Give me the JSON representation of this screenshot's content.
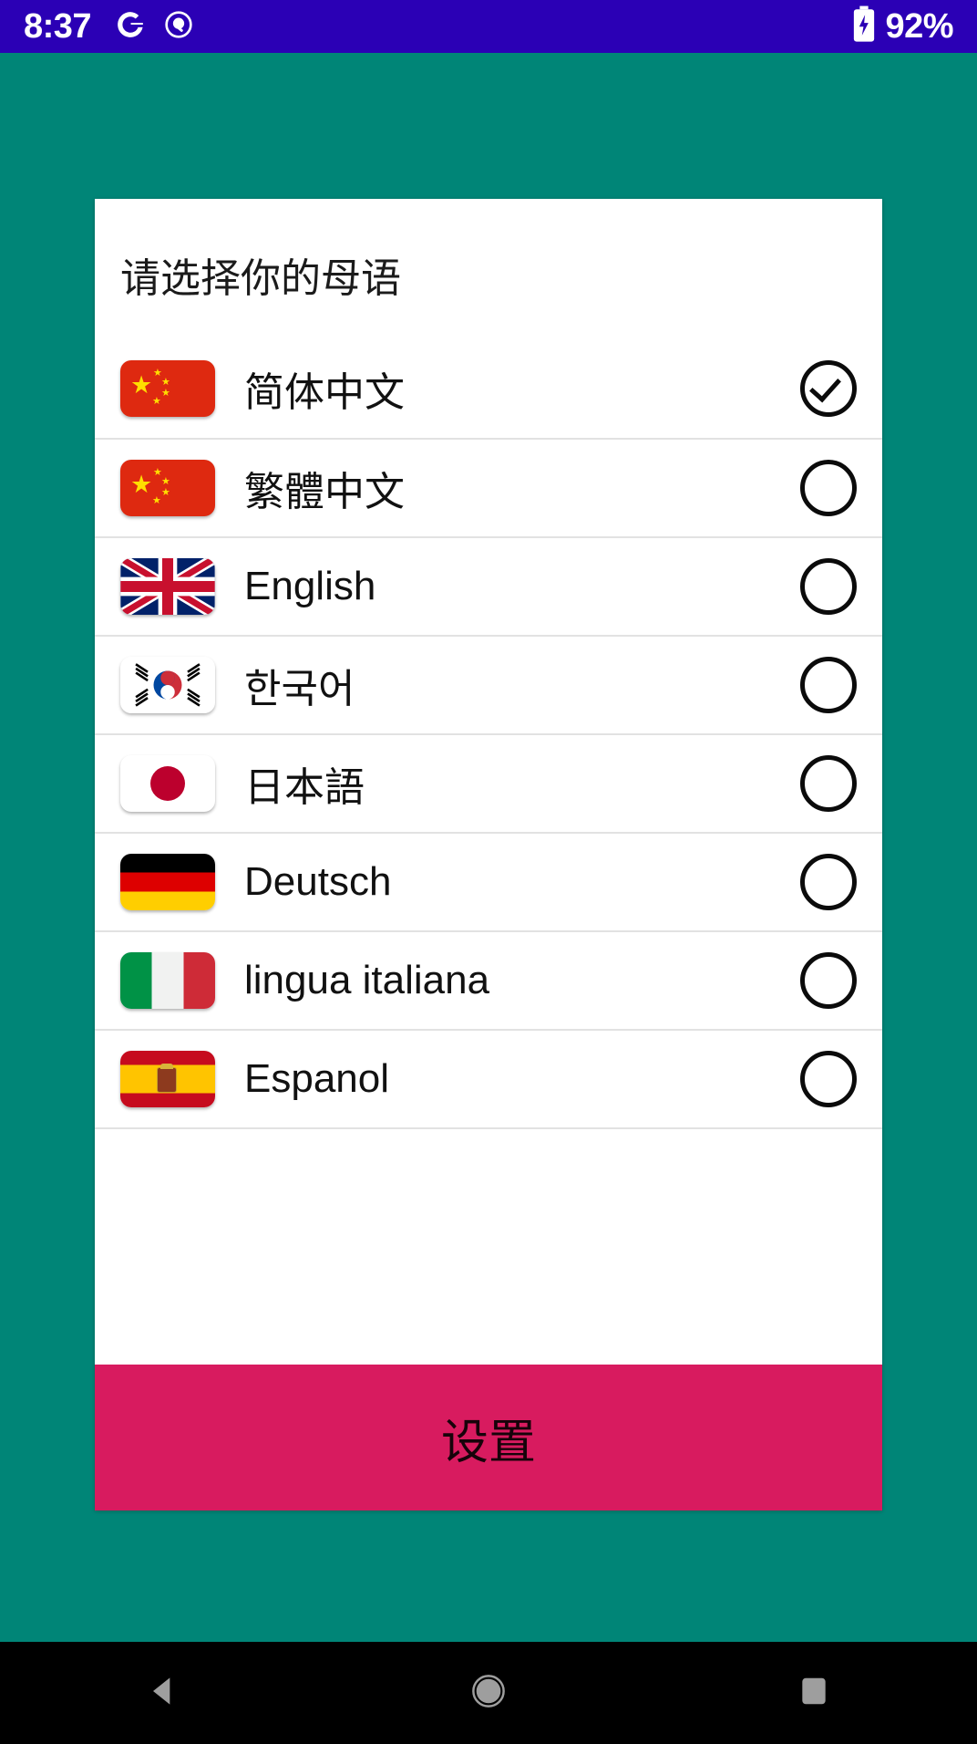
{
  "status_bar": {
    "clock": "8:37",
    "left_icons": [
      "google-g-icon",
      "dnd-icon"
    ],
    "battery_icon": "battery-charging-icon",
    "battery_percent": "92%",
    "background_color": "#2B00B5"
  },
  "background_color": "#008577",
  "card": {
    "title": "请选择你的母语",
    "background_color": "#FFFFFF",
    "languages": [
      {
        "label": "简体中文",
        "flag": "flag-china",
        "selected": true
      },
      {
        "label": "繁體中文",
        "flag": "flag-china",
        "selected": false
      },
      {
        "label": "English",
        "flag": "flag-united-kingdom",
        "selected": false
      },
      {
        "label": "한국어",
        "flag": "flag-south-korea",
        "selected": false
      },
      {
        "label": "日本語",
        "flag": "flag-japan",
        "selected": false
      },
      {
        "label": "Deutsch",
        "flag": "flag-germany",
        "selected": false
      },
      {
        "label": "lingua italiana",
        "flag": "flag-italy",
        "selected": false
      },
      {
        "label": "Espanol",
        "flag": "flag-spain",
        "selected": false
      }
    ]
  },
  "confirm_button": {
    "label": "设置",
    "background_color": "#D81B5F",
    "text_color": "#17030A"
  },
  "nav_bar": {
    "background_color": "#000000",
    "buttons": [
      "back-icon",
      "home-icon",
      "recents-icon"
    ]
  }
}
